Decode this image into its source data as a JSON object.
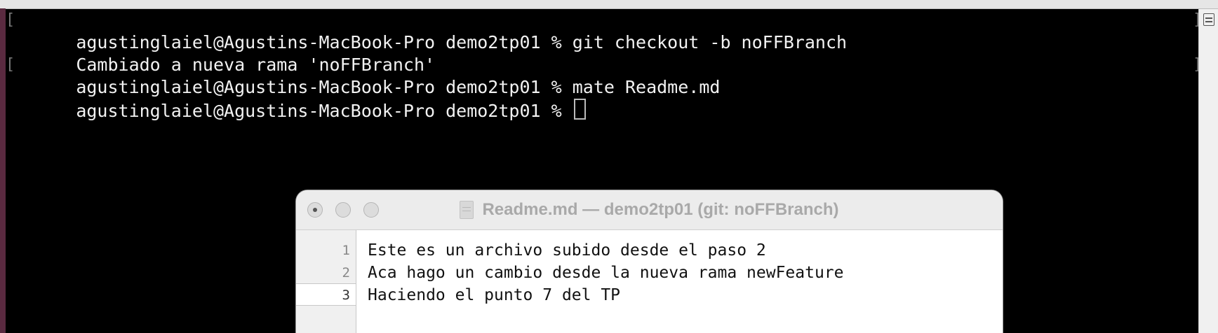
{
  "terminal": {
    "lines": [
      "agustinglaiel@Agustins-MacBook-Pro demo2tp01 % git checkout -b noFFBranch",
      "Cambiado a nueva rama 'noFFBranch'",
      "agustinglaiel@Agustins-MacBook-Pro demo2tp01 % mate Readme.md",
      "agustinglaiel@Agustins-MacBook-Pro demo2tp01 % "
    ]
  },
  "editor": {
    "title": "Readme.md — demo2tp01 (git: noFFBranch)",
    "line_numbers": [
      "1",
      "2",
      "3"
    ],
    "lines": [
      "Este es un archivo subido desde el paso 2",
      "Aca hago un cambio desde la nueva rama newFeature",
      "Haciendo el punto 7 del TP"
    ]
  },
  "icons": {
    "split": "split-pane-icon",
    "close": "close-button-icon",
    "minimize": "minimize-button-icon",
    "zoom": "zoom-button-icon",
    "document": "document-icon"
  }
}
